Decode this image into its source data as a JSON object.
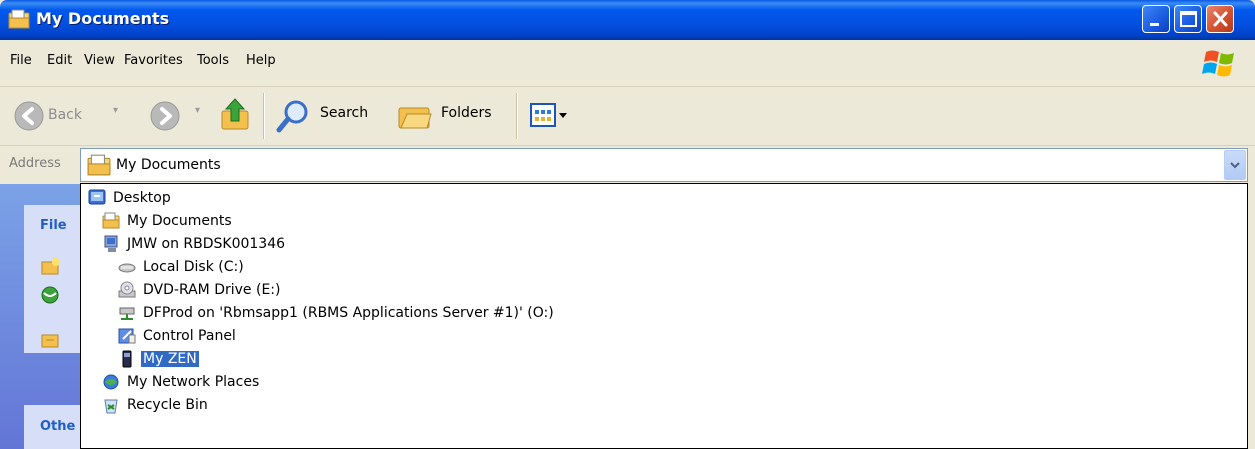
{
  "window": {
    "title": "My Documents"
  },
  "menu": [
    "File",
    "Edit",
    "View",
    "Favorites",
    "Tools",
    "Help"
  ],
  "toolbar": {
    "back_label": "Back",
    "search_label": "Search",
    "folders_label": "Folders"
  },
  "address": {
    "label": "Address",
    "value": "My Documents"
  },
  "taskpane": {
    "file_heading": "File",
    "other_heading": "Othe"
  },
  "dropdown": {
    "items": [
      {
        "label": "Desktop",
        "icon": "desktop-icon",
        "level": 0
      },
      {
        "label": "My Documents",
        "icon": "my-documents-icon",
        "level": 1
      },
      {
        "label": "JMW on RBDSK001346",
        "icon": "computer-icon",
        "level": 1
      },
      {
        "label": "Local Disk (C:)",
        "icon": "hard-disk-icon",
        "level": 2
      },
      {
        "label": "DVD-RAM Drive (E:)",
        "icon": "dvd-drive-icon",
        "level": 2
      },
      {
        "label": "DFProd on 'Rbmsapp1 (RBMS Applications Server #1)' (O:)",
        "icon": "network-drive-icon",
        "level": 2
      },
      {
        "label": "Control Panel",
        "icon": "control-panel-icon",
        "level": 2
      },
      {
        "label": "My ZEN",
        "icon": "media-player-icon",
        "level": 2,
        "selected": true
      },
      {
        "label": "My Network Places",
        "icon": "network-places-icon",
        "level": 1
      },
      {
        "label": "Recycle Bin",
        "icon": "recycle-bin-icon",
        "level": 1
      }
    ]
  },
  "colors": {
    "titlebar": "#0054E3",
    "selection": "#316AC5",
    "chrome": "#ECE9D8"
  }
}
